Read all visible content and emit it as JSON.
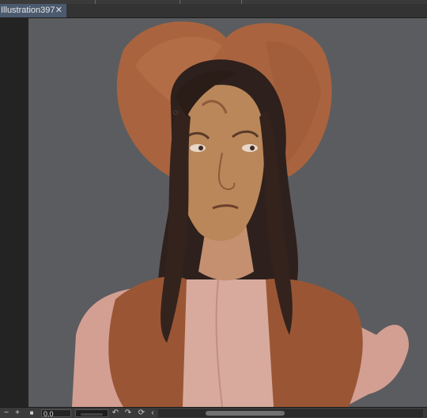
{
  "document_tab": {
    "title": "Illustration397",
    "close_symbol": "✕"
  },
  "footer": {
    "minus_symbol": "−",
    "plus_symbol": "+",
    "stop_symbol": "■",
    "zoom_value": "0.0",
    "undo_symbol": "↶",
    "redo_symbol": "↷",
    "reset_symbol": "⟳",
    "collapse_symbol": "‹"
  },
  "colors": {
    "canvas_bg": "#5b5c5f",
    "tab_active": "#4b5a6e",
    "hat": "#a9643f",
    "skin": "#b98759",
    "hair": "#2e201c",
    "shirt": "#d39f93",
    "vest": "#9a5634"
  }
}
